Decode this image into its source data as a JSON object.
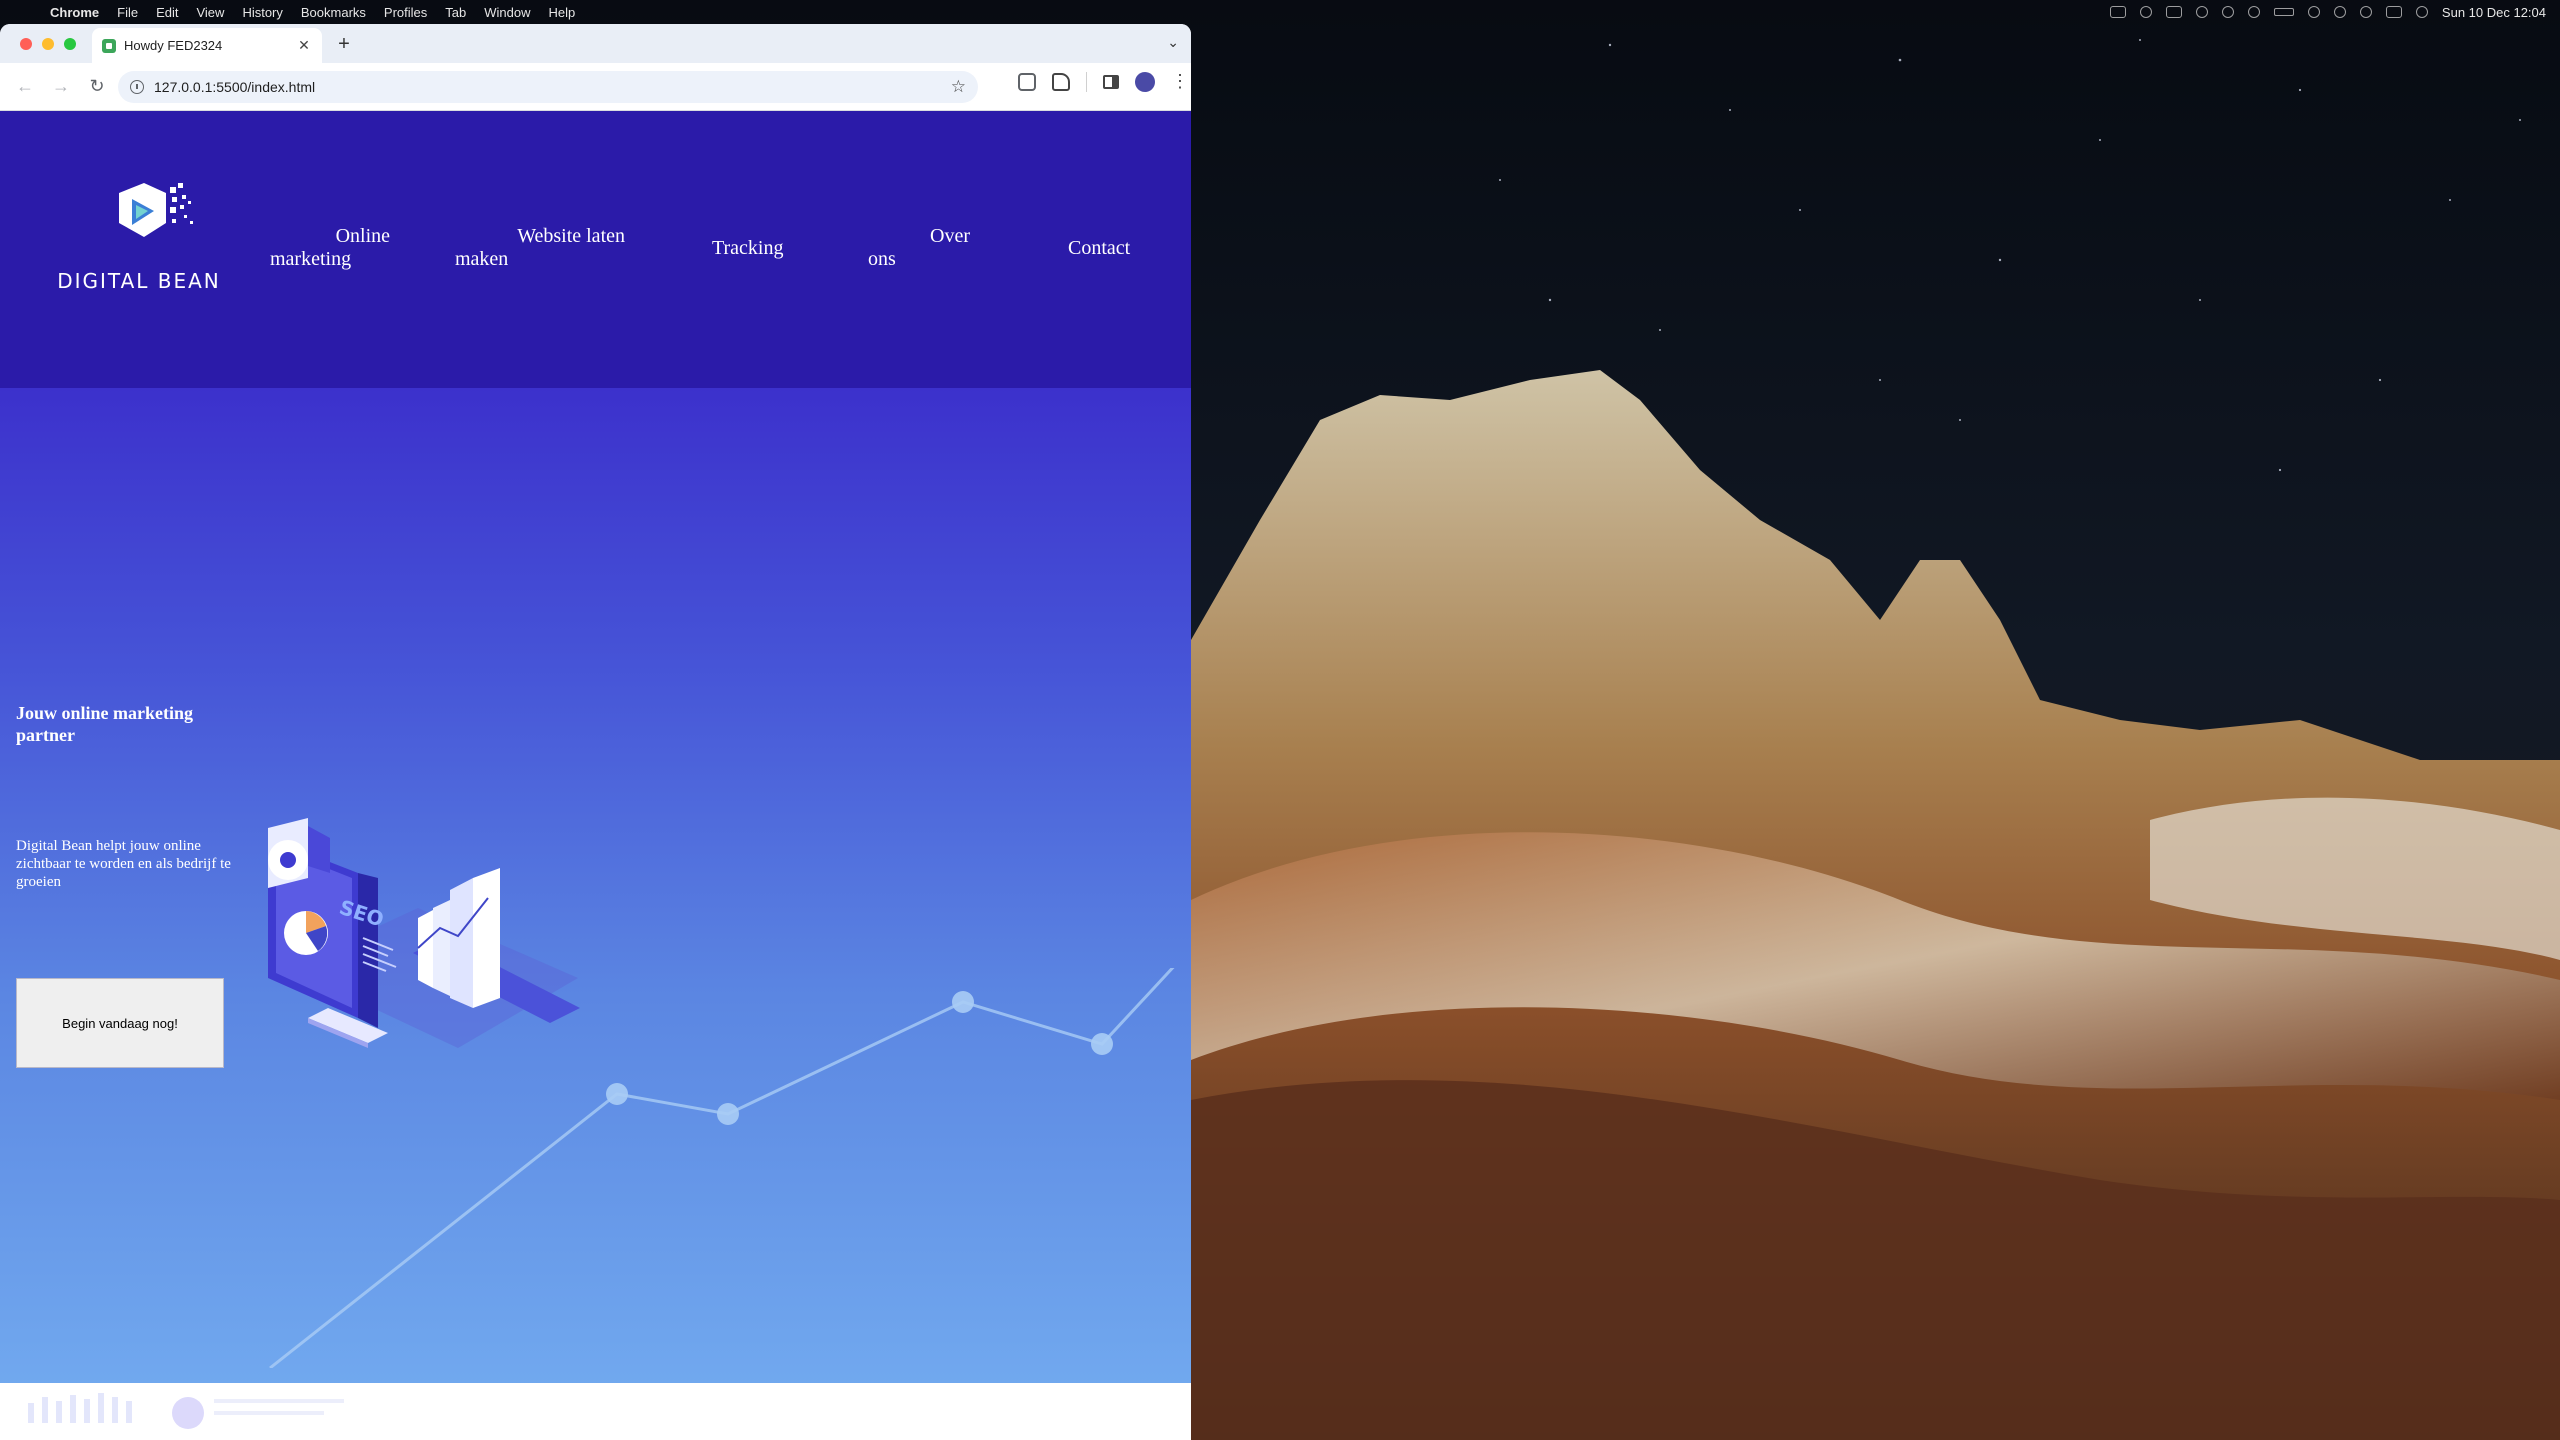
{
  "menubar": {
    "app_name": "Chrome",
    "items": [
      "File",
      "Edit",
      "View",
      "History",
      "Bookmarks",
      "Profiles",
      "Tab",
      "Window",
      "Help"
    ],
    "clock": "Sun 10 Dec  12:04"
  },
  "browser": {
    "tab_title": "Howdy FED2324",
    "url": "127.0.0.1:5500/index.html"
  },
  "site": {
    "logo_text": "DIGITAL BEAN",
    "nav": [
      {
        "line1": "Online",
        "line2": "marketing"
      },
      {
        "line1": "Website laten",
        "line2": "maken"
      },
      {
        "line1": "Tracking",
        "line2": ""
      },
      {
        "line1": "Over",
        "line2": "ons"
      },
      {
        "line1": "Contact",
        "line2": ""
      }
    ],
    "hero_title": "Jouw online marketing partner",
    "hero_text": "Digital Bean helpt jouw online zichtbaar te worden en als bedrijf te groeien",
    "cta_label": "Begin vandaag nog!",
    "illustration_label": "SEO"
  },
  "colors": {
    "header_bg": "#2b1ba9",
    "hero_top": "#3c31cc",
    "hero_bottom": "#77b2f2"
  }
}
